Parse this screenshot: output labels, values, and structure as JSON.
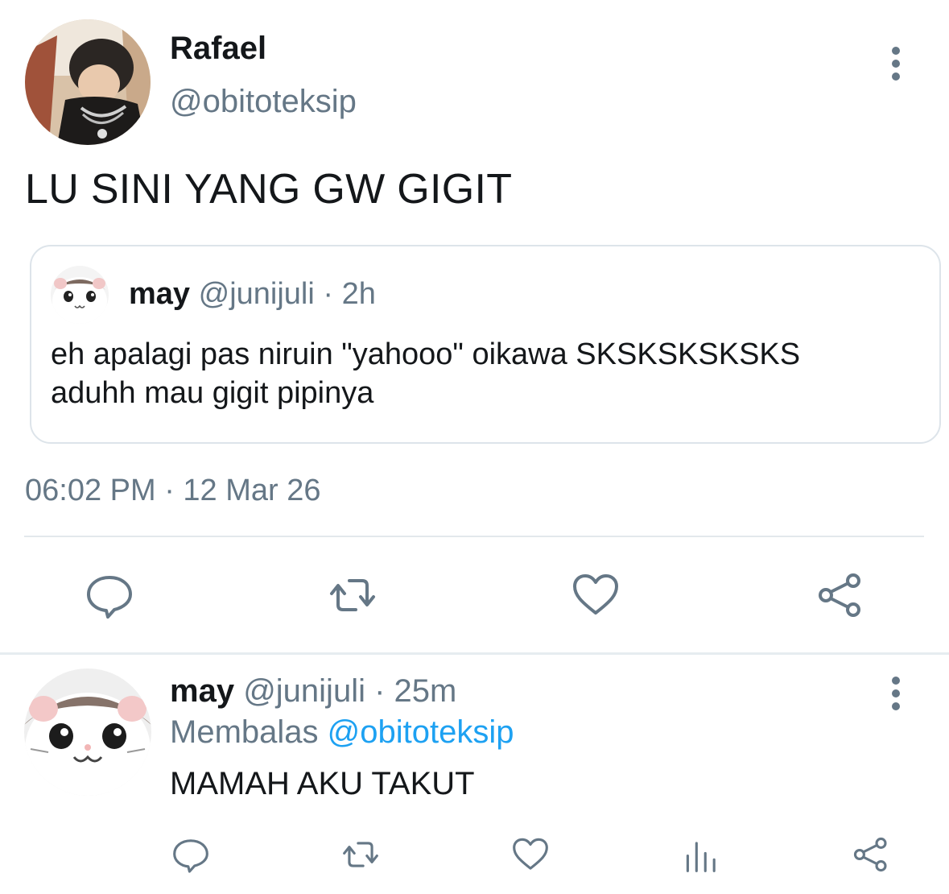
{
  "tweet": {
    "author_name": "Rafael",
    "author_handle": "@obitoteksip",
    "text": "LU SINI YANG GW GIGIT",
    "timestamp": "06:02 PM · 12 Mar 26",
    "menu_icon": "more-vertical-icon",
    "avatar_icon": "profile-photo"
  },
  "quoted": {
    "name": "may",
    "handle": "@junijuli",
    "time": "· 2h",
    "text_line1": "eh apalagi pas niruin \"yahooo\" oikawa SKSKSKSKSKS",
    "text_line2": "aduhh mau gigit pipinya",
    "avatar_icon": "hamster-avatar"
  },
  "actions": {
    "reply_icon": "comment-icon",
    "retweet_icon": "retweet-icon",
    "like_icon": "heart-icon",
    "share_icon": "share-icon"
  },
  "reply": {
    "name": "may",
    "handle": "@junijuli",
    "time": "· 25m",
    "replying_label": "Membalas",
    "replying_to": "@obitoteksip",
    "text": "MAMAH AKU TAKUT",
    "avatar_icon": "hamster-avatar",
    "menu_icon": "more-vertical-icon",
    "actions": [
      "comment-icon",
      "retweet-icon",
      "heart-icon",
      "analytics-icon",
      "share-icon"
    ]
  },
  "colors": {
    "text_primary": "#14171a",
    "text_secondary": "#657786",
    "link": "#1da1f2",
    "border": "#dde4ea"
  }
}
